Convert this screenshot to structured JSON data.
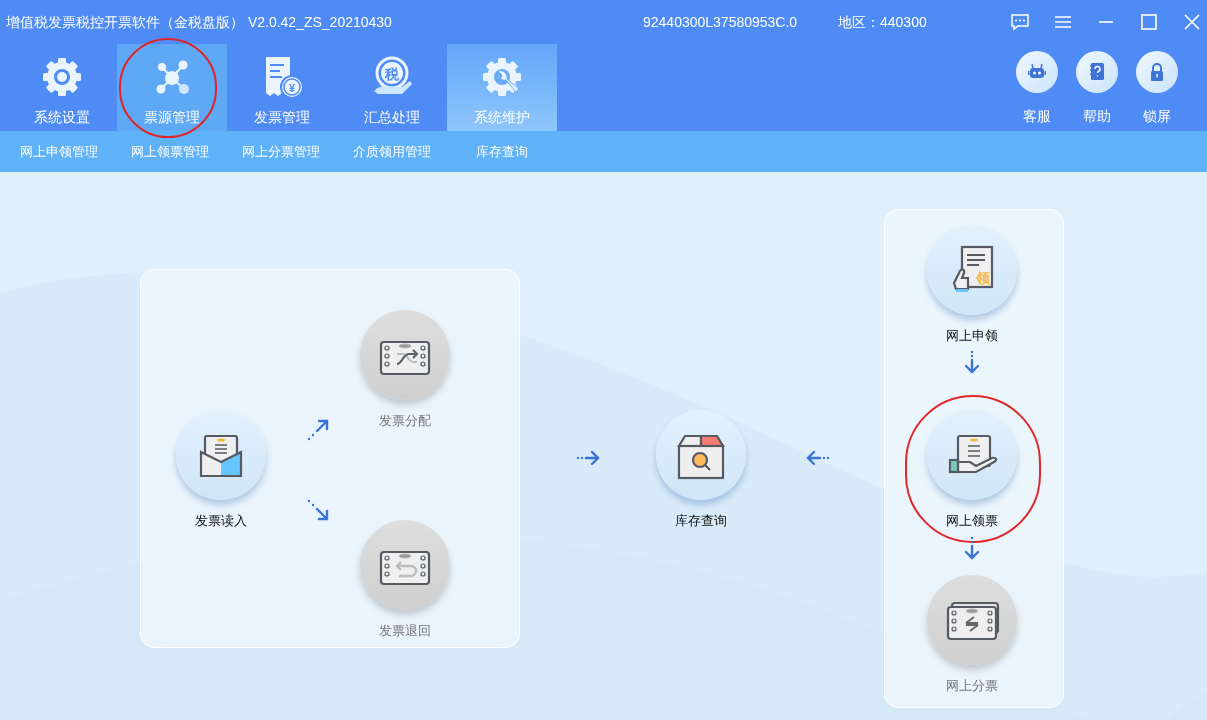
{
  "window": {
    "title": "增值税发票税控开票软件（金税盘版） V2.0.42_ZS_20210430",
    "tax_id": "92440300L37580953C.0",
    "region": "地区：440300"
  },
  "toolbar": [
    {
      "label": "系统设置",
      "selected": false,
      "hovered": false,
      "circled": false
    },
    {
      "label": "票源管理",
      "selected": true,
      "hovered": false,
      "circled": true
    },
    {
      "label": "发票管理",
      "selected": false,
      "hovered": false,
      "circled": false,
      "icon_text": "¥"
    },
    {
      "label": "汇总处理",
      "selected": false,
      "hovered": false,
      "circled": false,
      "icon_text": "税"
    },
    {
      "label": "系统维护",
      "selected": false,
      "hovered": true,
      "circled": false
    }
  ],
  "quick_buttons": [
    {
      "label": "客服"
    },
    {
      "label": "帮助"
    },
    {
      "label": "锁屏"
    }
  ],
  "subnav": [
    {
      "label": "网上申领管理"
    },
    {
      "label": "网上领票管理"
    },
    {
      "label": "网上分票管理"
    },
    {
      "label": "介质领用管理"
    },
    {
      "label": "库存查询"
    }
  ],
  "flow_nodes": [
    {
      "label": "发票读入",
      "enabled": true,
      "circled": false
    },
    {
      "label": "发票分配",
      "enabled": false,
      "circled": false
    },
    {
      "label": "发票退回",
      "enabled": false,
      "circled": false
    },
    {
      "label": "库存查询",
      "enabled": true,
      "circled": false
    },
    {
      "label": "网上申领",
      "enabled": true,
      "circled": false,
      "icon_text": "领"
    },
    {
      "label": "网上领票",
      "enabled": true,
      "circled": true
    },
    {
      "label": "网上分票",
      "enabled": false,
      "circled": false
    }
  ]
}
